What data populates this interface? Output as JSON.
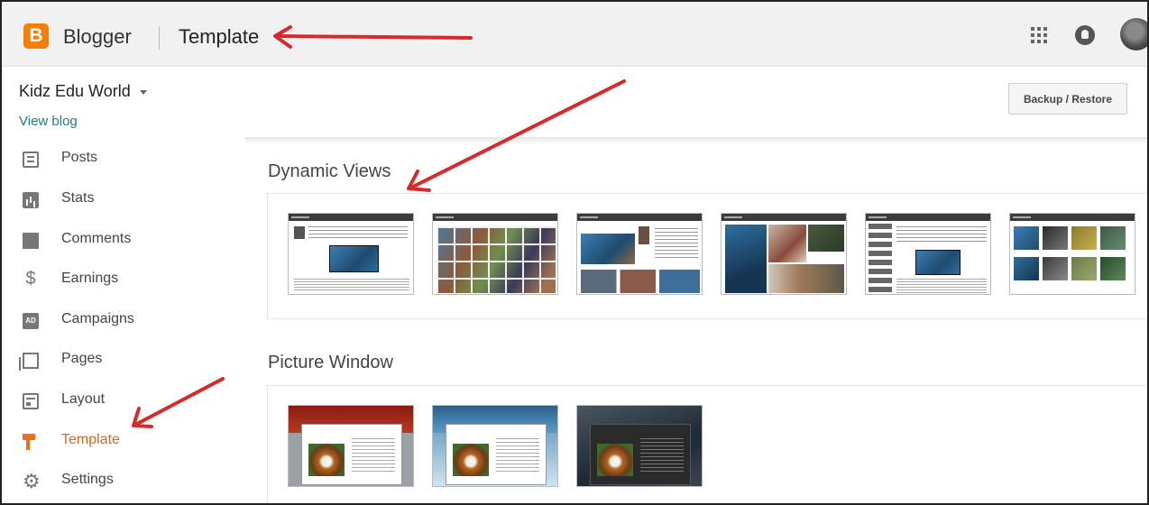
{
  "header": {
    "logo_letter": "B",
    "brand": "Blogger",
    "page_title": "Template",
    "icons": [
      "apps-grid-icon",
      "notifications-icon",
      "avatar"
    ]
  },
  "blog": {
    "name": "Kidz Edu World",
    "view_blog": "View blog",
    "backup_restore": "Backup / Restore"
  },
  "sidebar": {
    "items": [
      {
        "label": "Posts",
        "icon": "posts-icon"
      },
      {
        "label": "Stats",
        "icon": "stats-icon"
      },
      {
        "label": "Comments",
        "icon": "comments-icon"
      },
      {
        "label": "Earnings",
        "icon": "dollar-icon",
        "glyph": "$"
      },
      {
        "label": "Campaigns",
        "icon": "campaigns-icon",
        "glyph": "AD"
      },
      {
        "label": "Pages",
        "icon": "pages-icon"
      },
      {
        "label": "Layout",
        "icon": "layout-icon"
      },
      {
        "label": "Template",
        "icon": "template-icon",
        "active": true
      },
      {
        "label": "Settings",
        "icon": "gear-icon",
        "glyph": "⚙"
      }
    ]
  },
  "sections": {
    "dynamic_views": "Dynamic Views",
    "picture_window": "Picture Window"
  },
  "colors": {
    "brand_orange": "#f57d00",
    "active_nav": "#d9661e",
    "link_teal": "#1f7f7a",
    "annotation_red": "#d62b2b"
  }
}
